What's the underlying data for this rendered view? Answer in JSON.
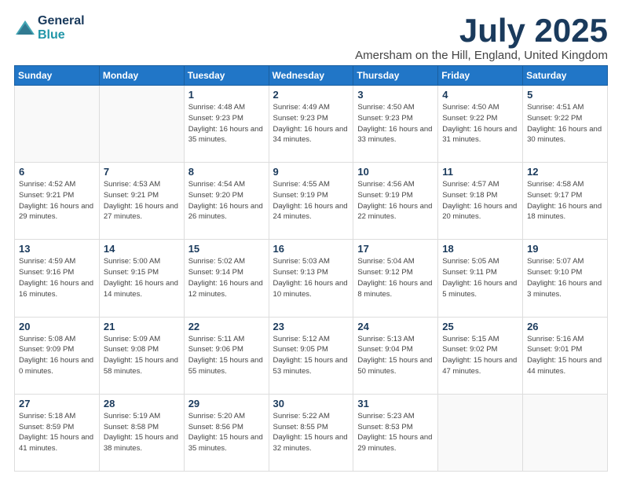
{
  "header": {
    "logo_line1": "General",
    "logo_line2": "Blue",
    "month_title": "July 2025",
    "subtitle": "Amersham on the Hill, England, United Kingdom"
  },
  "weekdays": [
    "Sunday",
    "Monday",
    "Tuesday",
    "Wednesday",
    "Thursday",
    "Friday",
    "Saturday"
  ],
  "weeks": [
    [
      {
        "day": "",
        "sunrise": "",
        "sunset": "",
        "daylight": ""
      },
      {
        "day": "",
        "sunrise": "",
        "sunset": "",
        "daylight": ""
      },
      {
        "day": "1",
        "sunrise": "Sunrise: 4:48 AM",
        "sunset": "Sunset: 9:23 PM",
        "daylight": "Daylight: 16 hours and 35 minutes."
      },
      {
        "day": "2",
        "sunrise": "Sunrise: 4:49 AM",
        "sunset": "Sunset: 9:23 PM",
        "daylight": "Daylight: 16 hours and 34 minutes."
      },
      {
        "day": "3",
        "sunrise": "Sunrise: 4:50 AM",
        "sunset": "Sunset: 9:23 PM",
        "daylight": "Daylight: 16 hours and 33 minutes."
      },
      {
        "day": "4",
        "sunrise": "Sunrise: 4:50 AM",
        "sunset": "Sunset: 9:22 PM",
        "daylight": "Daylight: 16 hours and 31 minutes."
      },
      {
        "day": "5",
        "sunrise": "Sunrise: 4:51 AM",
        "sunset": "Sunset: 9:22 PM",
        "daylight": "Daylight: 16 hours and 30 minutes."
      }
    ],
    [
      {
        "day": "6",
        "sunrise": "Sunrise: 4:52 AM",
        "sunset": "Sunset: 9:21 PM",
        "daylight": "Daylight: 16 hours and 29 minutes."
      },
      {
        "day": "7",
        "sunrise": "Sunrise: 4:53 AM",
        "sunset": "Sunset: 9:21 PM",
        "daylight": "Daylight: 16 hours and 27 minutes."
      },
      {
        "day": "8",
        "sunrise": "Sunrise: 4:54 AM",
        "sunset": "Sunset: 9:20 PM",
        "daylight": "Daylight: 16 hours and 26 minutes."
      },
      {
        "day": "9",
        "sunrise": "Sunrise: 4:55 AM",
        "sunset": "Sunset: 9:19 PM",
        "daylight": "Daylight: 16 hours and 24 minutes."
      },
      {
        "day": "10",
        "sunrise": "Sunrise: 4:56 AM",
        "sunset": "Sunset: 9:19 PM",
        "daylight": "Daylight: 16 hours and 22 minutes."
      },
      {
        "day": "11",
        "sunrise": "Sunrise: 4:57 AM",
        "sunset": "Sunset: 9:18 PM",
        "daylight": "Daylight: 16 hours and 20 minutes."
      },
      {
        "day": "12",
        "sunrise": "Sunrise: 4:58 AM",
        "sunset": "Sunset: 9:17 PM",
        "daylight": "Daylight: 16 hours and 18 minutes."
      }
    ],
    [
      {
        "day": "13",
        "sunrise": "Sunrise: 4:59 AM",
        "sunset": "Sunset: 9:16 PM",
        "daylight": "Daylight: 16 hours and 16 minutes."
      },
      {
        "day": "14",
        "sunrise": "Sunrise: 5:00 AM",
        "sunset": "Sunset: 9:15 PM",
        "daylight": "Daylight: 16 hours and 14 minutes."
      },
      {
        "day": "15",
        "sunrise": "Sunrise: 5:02 AM",
        "sunset": "Sunset: 9:14 PM",
        "daylight": "Daylight: 16 hours and 12 minutes."
      },
      {
        "day": "16",
        "sunrise": "Sunrise: 5:03 AM",
        "sunset": "Sunset: 9:13 PM",
        "daylight": "Daylight: 16 hours and 10 minutes."
      },
      {
        "day": "17",
        "sunrise": "Sunrise: 5:04 AM",
        "sunset": "Sunset: 9:12 PM",
        "daylight": "Daylight: 16 hours and 8 minutes."
      },
      {
        "day": "18",
        "sunrise": "Sunrise: 5:05 AM",
        "sunset": "Sunset: 9:11 PM",
        "daylight": "Daylight: 16 hours and 5 minutes."
      },
      {
        "day": "19",
        "sunrise": "Sunrise: 5:07 AM",
        "sunset": "Sunset: 9:10 PM",
        "daylight": "Daylight: 16 hours and 3 minutes."
      }
    ],
    [
      {
        "day": "20",
        "sunrise": "Sunrise: 5:08 AM",
        "sunset": "Sunset: 9:09 PM",
        "daylight": "Daylight: 16 hours and 0 minutes."
      },
      {
        "day": "21",
        "sunrise": "Sunrise: 5:09 AM",
        "sunset": "Sunset: 9:08 PM",
        "daylight": "Daylight: 15 hours and 58 minutes."
      },
      {
        "day": "22",
        "sunrise": "Sunrise: 5:11 AM",
        "sunset": "Sunset: 9:06 PM",
        "daylight": "Daylight: 15 hours and 55 minutes."
      },
      {
        "day": "23",
        "sunrise": "Sunrise: 5:12 AM",
        "sunset": "Sunset: 9:05 PM",
        "daylight": "Daylight: 15 hours and 53 minutes."
      },
      {
        "day": "24",
        "sunrise": "Sunrise: 5:13 AM",
        "sunset": "Sunset: 9:04 PM",
        "daylight": "Daylight: 15 hours and 50 minutes."
      },
      {
        "day": "25",
        "sunrise": "Sunrise: 5:15 AM",
        "sunset": "Sunset: 9:02 PM",
        "daylight": "Daylight: 15 hours and 47 minutes."
      },
      {
        "day": "26",
        "sunrise": "Sunrise: 5:16 AM",
        "sunset": "Sunset: 9:01 PM",
        "daylight": "Daylight: 15 hours and 44 minutes."
      }
    ],
    [
      {
        "day": "27",
        "sunrise": "Sunrise: 5:18 AM",
        "sunset": "Sunset: 8:59 PM",
        "daylight": "Daylight: 15 hours and 41 minutes."
      },
      {
        "day": "28",
        "sunrise": "Sunrise: 5:19 AM",
        "sunset": "Sunset: 8:58 PM",
        "daylight": "Daylight: 15 hours and 38 minutes."
      },
      {
        "day": "29",
        "sunrise": "Sunrise: 5:20 AM",
        "sunset": "Sunset: 8:56 PM",
        "daylight": "Daylight: 15 hours and 35 minutes."
      },
      {
        "day": "30",
        "sunrise": "Sunrise: 5:22 AM",
        "sunset": "Sunset: 8:55 PM",
        "daylight": "Daylight: 15 hours and 32 minutes."
      },
      {
        "day": "31",
        "sunrise": "Sunrise: 5:23 AM",
        "sunset": "Sunset: 8:53 PM",
        "daylight": "Daylight: 15 hours and 29 minutes."
      },
      {
        "day": "",
        "sunrise": "",
        "sunset": "",
        "daylight": ""
      },
      {
        "day": "",
        "sunrise": "",
        "sunset": "",
        "daylight": ""
      }
    ]
  ]
}
